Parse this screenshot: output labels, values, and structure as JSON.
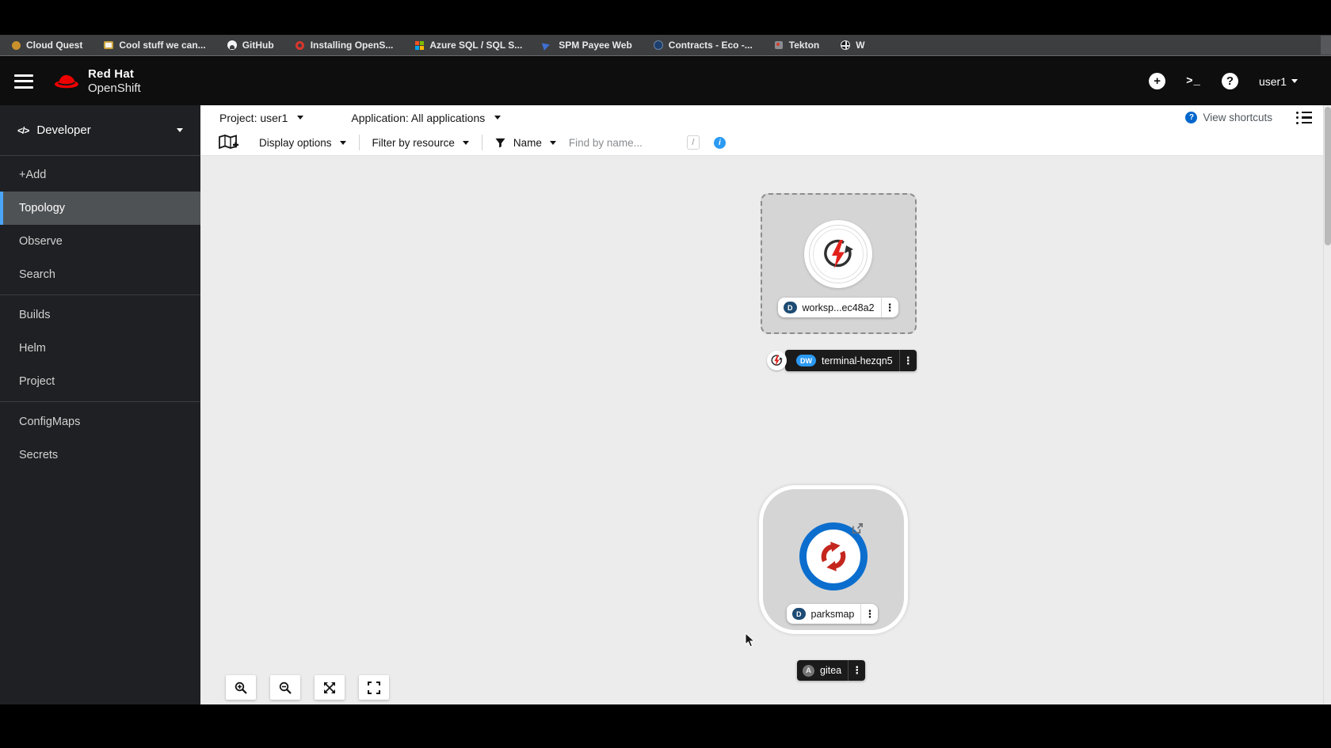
{
  "browser": {
    "bookmarks": [
      {
        "label": "Cloud Quest",
        "icon": "orange-circle-icon"
      },
      {
        "label": "Cool stuff we can...",
        "icon": "window-icon"
      },
      {
        "label": "GitHub",
        "icon": "github-icon"
      },
      {
        "label": "Installing OpenS...",
        "icon": "red-ring-icon"
      },
      {
        "label": "Azure SQL / SQL S...",
        "icon": "microsoft-grid-icon"
      },
      {
        "label": "SPM Payee Web",
        "icon": "blue-mark-icon"
      },
      {
        "label": "Contracts - Eco -...",
        "icon": "navy-circle-icon"
      },
      {
        "label": "Tekton",
        "icon": "tekton-icon"
      },
      {
        "label": "W",
        "icon": "globe-icon"
      }
    ]
  },
  "header": {
    "brand_line1": "Red Hat",
    "brand_line2": "OpenShift",
    "terminal_glyph": ">_",
    "plus_glyph": "+",
    "help_glyph": "?",
    "user": "user1"
  },
  "sidebar": {
    "perspective": "Developer",
    "perspective_icon_glyph": "</>",
    "items": [
      {
        "label": "+Add"
      },
      {
        "label": "Topology"
      },
      {
        "label": "Observe"
      },
      {
        "label": "Search"
      },
      {
        "label": "Builds"
      },
      {
        "label": "Helm"
      },
      {
        "label": "Project"
      },
      {
        "label": "ConfigMaps"
      },
      {
        "label": "Secrets"
      }
    ],
    "selected_item": "Topology"
  },
  "context_bar": {
    "project": "Project: user1",
    "application": "Application: All applications",
    "view_shortcuts": "View shortcuts",
    "shortcuts_icon_glyph": "?"
  },
  "toolbar": {
    "display_options": "Display options",
    "filter_by_resource": "Filter by resource",
    "name_filter": "Name",
    "find_placeholder": "Find by name...",
    "shortcut_key": "/",
    "info_glyph": "i"
  },
  "topology": {
    "workspace": {
      "badge": "D",
      "label": "worksp...ec48a2",
      "kebab_glyph": "⋮"
    },
    "terminal": {
      "badge": "DW",
      "label": "terminal-hezqn5",
      "kebab_glyph": "⋮"
    },
    "parksmap": {
      "badge": "D",
      "label": "parksmap",
      "kebab_glyph": "⋮"
    },
    "gitea": {
      "badge": "A",
      "label": "gitea",
      "kebab_glyph": "⋮"
    }
  },
  "colors": {
    "accent_blue": "#2b9af3",
    "link_blue": "#0066cc",
    "brand_red": "#ee0000",
    "canvas_gray": "#ececec",
    "node_gray": "#d5d5d5",
    "nav_selected": "#4f5255",
    "deployment_badge_navy": "#1d4b73",
    "dark_label": "#1b1b1b",
    "bolt_red": "#e0211a",
    "parksmap_ring_blue": "#0b6ece",
    "parksmap_arrows_red": "#c4261e"
  }
}
